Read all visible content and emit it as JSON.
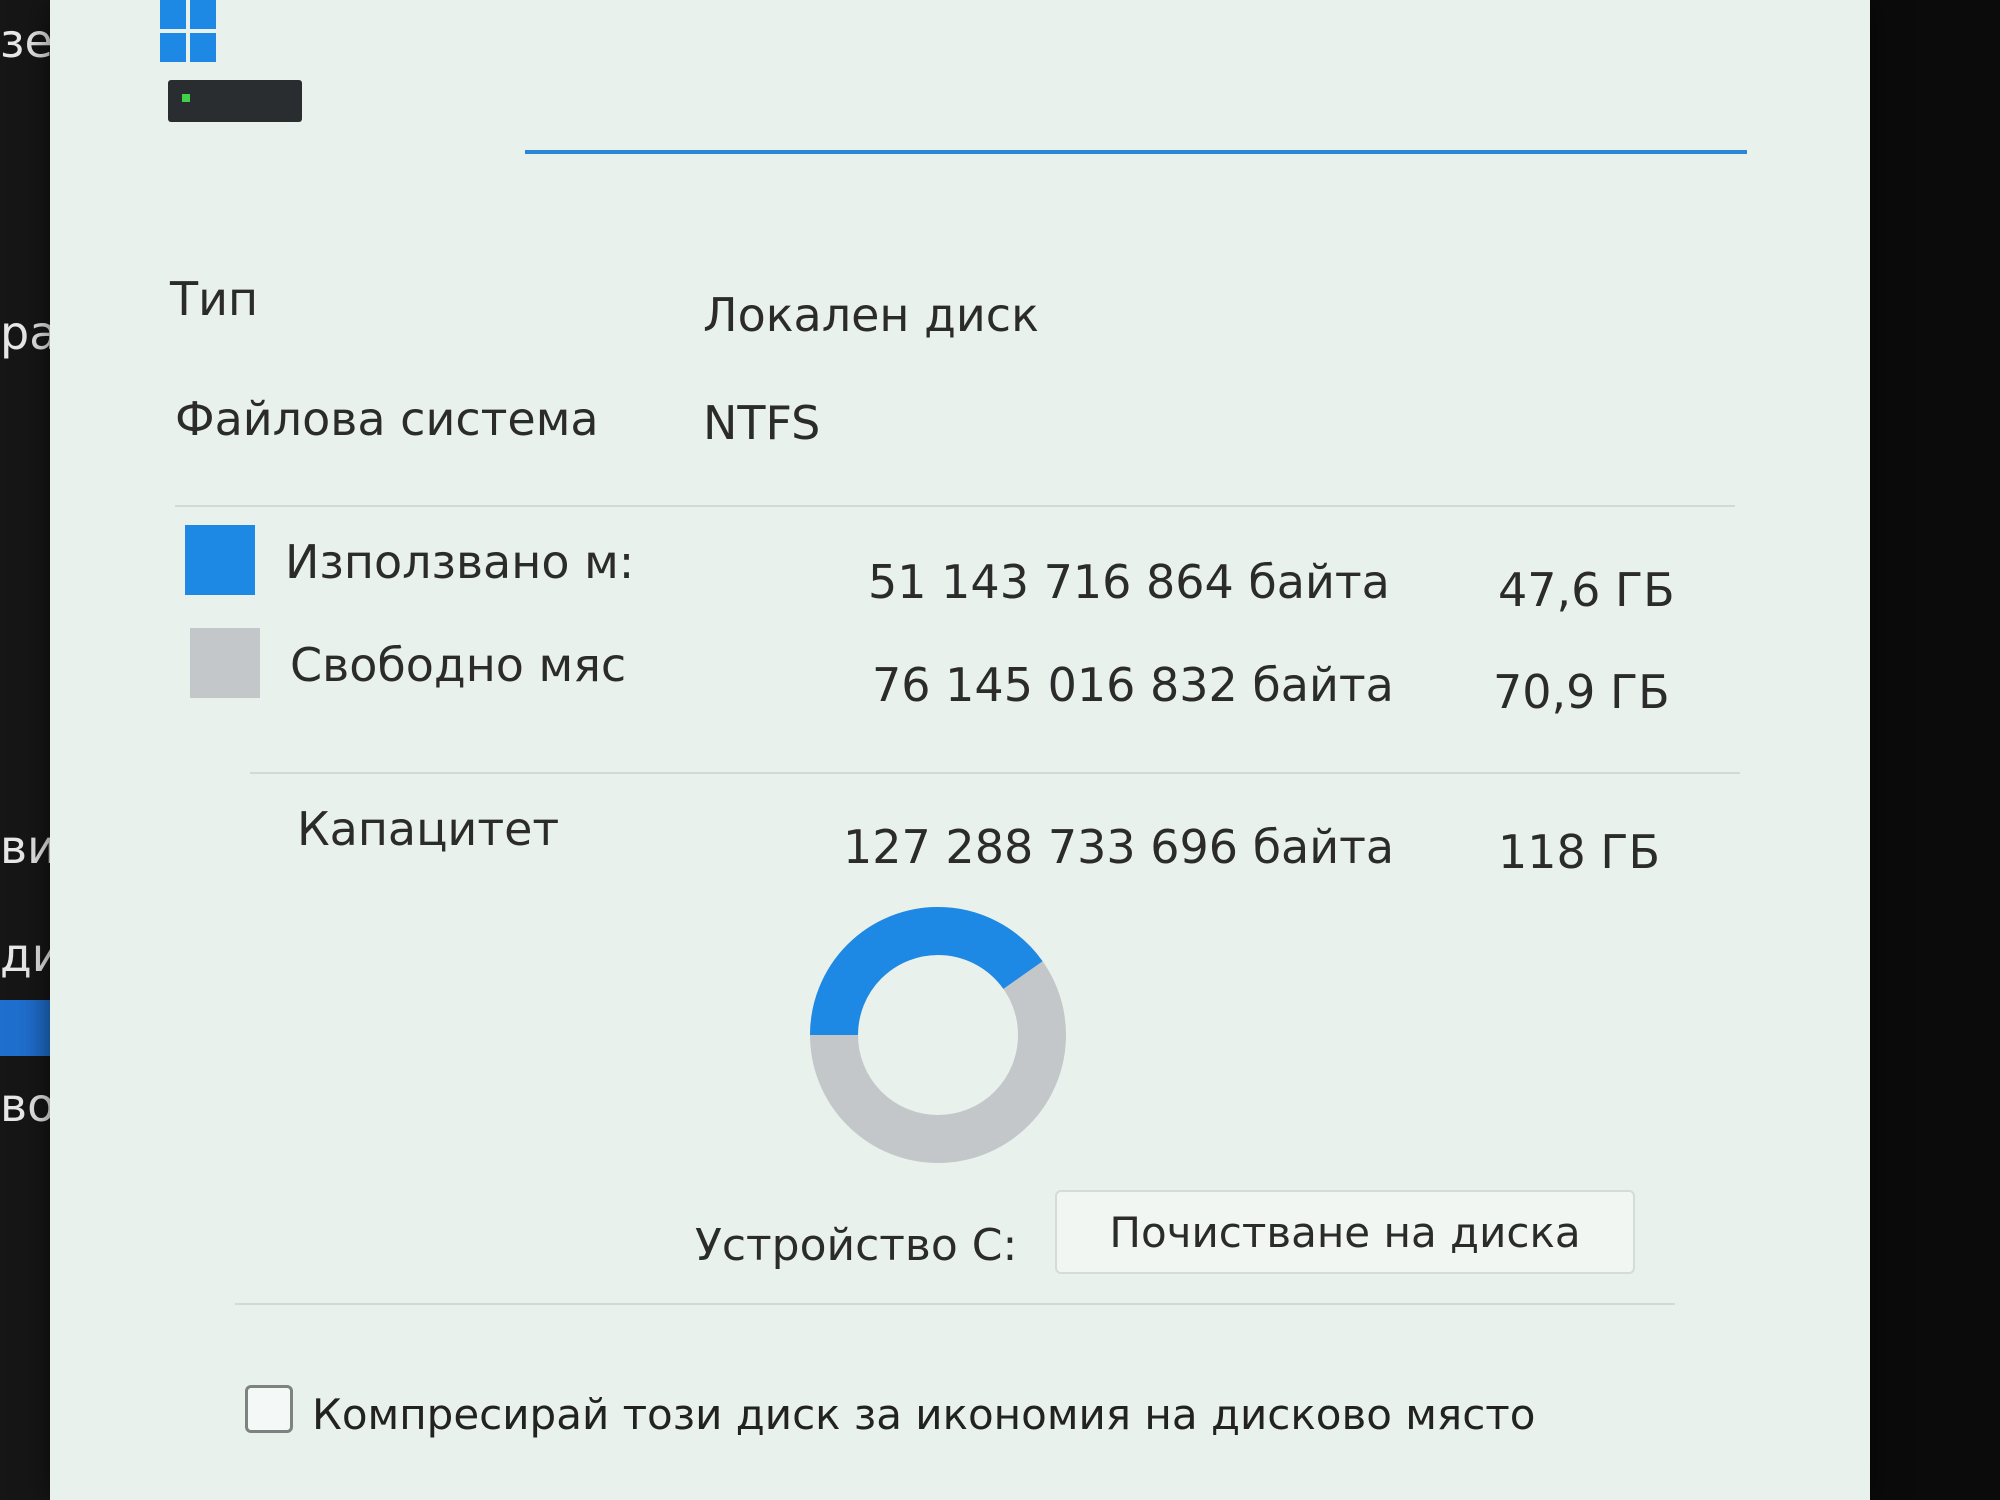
{
  "background_window": {
    "fragments": [
      "зе",
      "рай",
      "ви у",
      "диск",
      "вобо,"
    ]
  },
  "properties": {
    "type_label": "Тип",
    "type_value": "Локален диск",
    "fs_label": "Файлова система",
    "fs_value": "NTFS",
    "used": {
      "label": "Използвано м:",
      "bytes": "51 143 716 864 байта",
      "size": "47,6 ГБ",
      "color": "#1e88e5"
    },
    "free": {
      "label": "Свободно мяс",
      "bytes": "76 145 016 832 байта",
      "size": "70,9 ГБ",
      "color": "#c3c7c9"
    },
    "capacity": {
      "label": "Капацитет",
      "bytes": "127 288 733 696 байта",
      "size": "118 ГБ"
    },
    "used_fraction": 0.402,
    "drive_label": "Устройство C:",
    "cleanup_button": "Почистване на диска",
    "compress_label": "Компресирай този диск за икономия на дисково място",
    "compress_checked": false
  }
}
